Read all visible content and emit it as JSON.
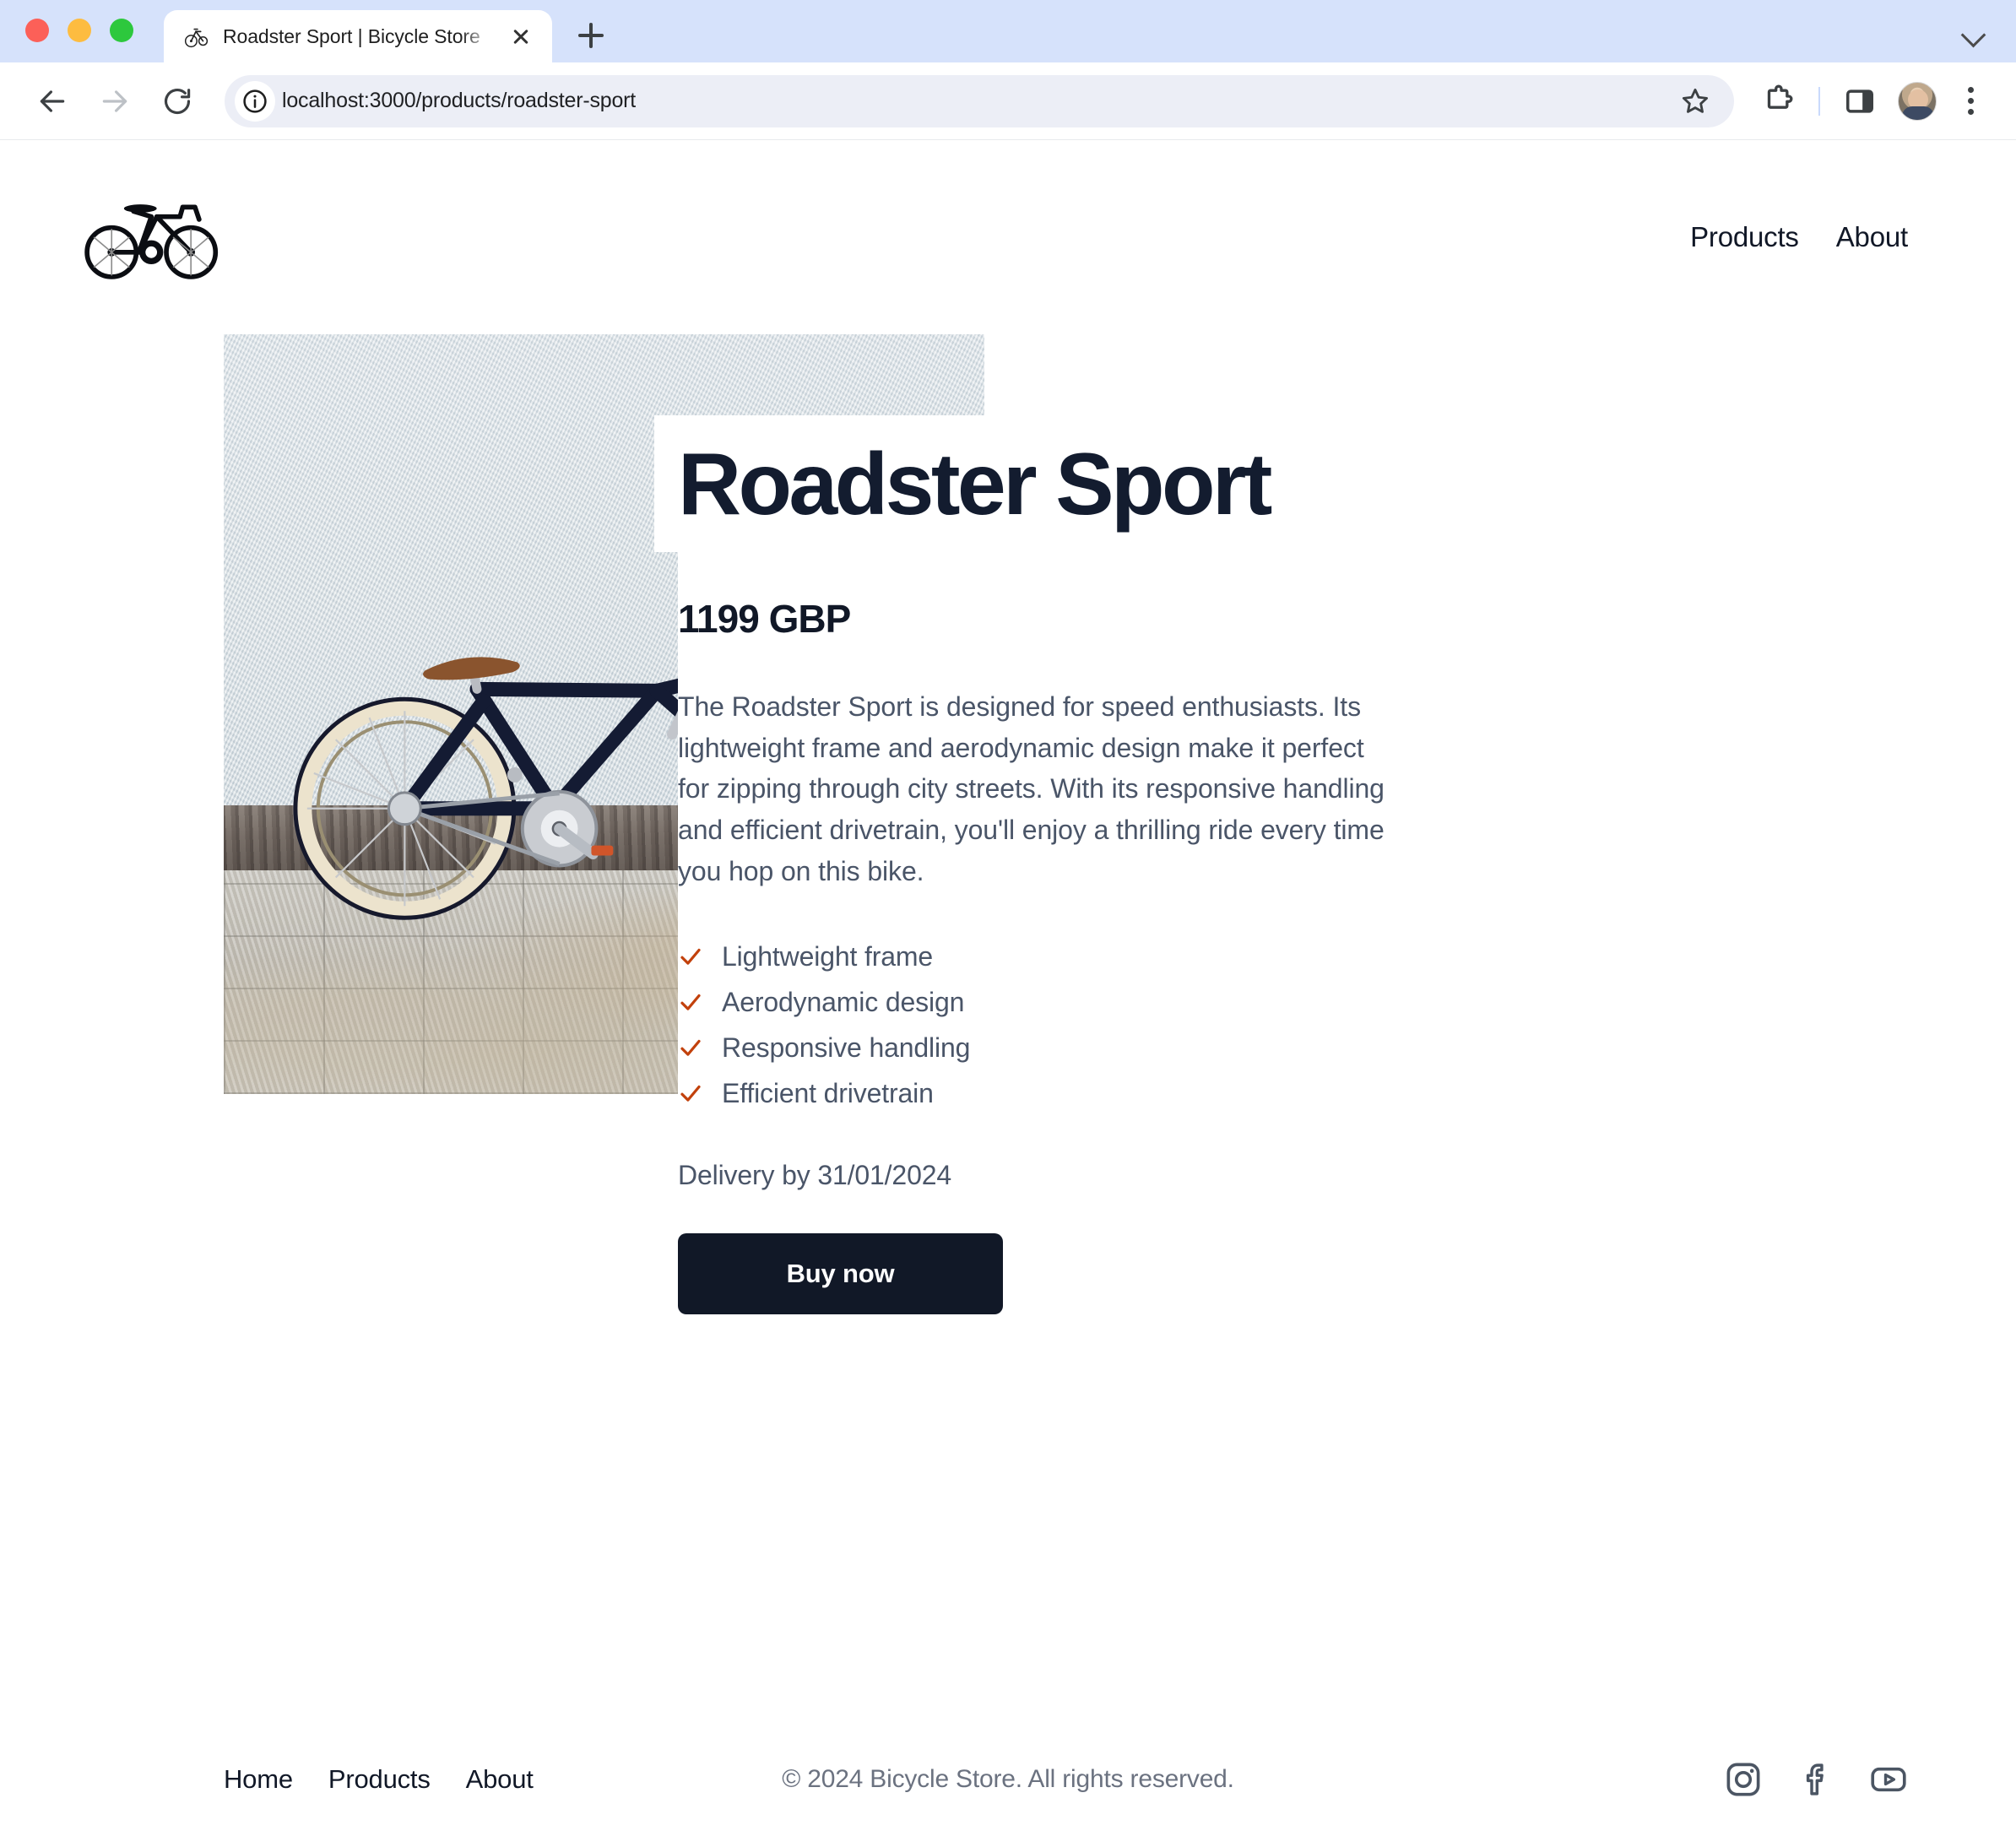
{
  "browser": {
    "tab": {
      "title": "Roadster Sport | Bicycle Store",
      "favicon_name": "bicycle-favicon",
      "close_label": "×"
    },
    "new_tab_label": "+",
    "toolbar": {
      "back_label": "Back",
      "forward_label": "Forward",
      "reload_label": "Reload",
      "site_info_label": "View site information",
      "url": "localhost:3000/products/roadster-sport",
      "bookmark_label": "Bookmark this tab",
      "extensions_label": "Extensions",
      "side_panel_label": "Side panel",
      "profile_label": "Profile",
      "menu_label": "Customize and control Google Chrome"
    },
    "tablist_menu_label": "Search tabs"
  },
  "header": {
    "logo_name": "bicycle-logo",
    "nav": [
      {
        "label": "Products",
        "name": "nav-products"
      },
      {
        "label": "About",
        "name": "nav-about"
      }
    ]
  },
  "product": {
    "image_alt": "Roadster Sport bicycle leaning against a white wall",
    "title": "Roadster Sport",
    "price": "1199 GBP",
    "description": "The Roadster Sport is designed for speed enthusiasts. Its lightweight frame and aerodynamic design make it perfect for zipping through city streets. With its responsive handling and efficient drivetrain, you'll enjoy a thrilling ride every time you hop on this bike.",
    "features": [
      "Lightweight frame",
      "Aerodynamic design",
      "Responsive handling",
      "Efficient drivetrain"
    ],
    "delivery": "Delivery by 31/01/2024",
    "buy_label": "Buy now"
  },
  "footer": {
    "nav": [
      {
        "label": "Home",
        "name": "footer-link-home"
      },
      {
        "label": "Products",
        "name": "footer-link-products"
      },
      {
        "label": "About",
        "name": "footer-link-about"
      }
    ],
    "copyright": "© 2024 Bicycle Store. All rights reserved.",
    "social": [
      {
        "name": "instagram-icon",
        "label": "Instagram"
      },
      {
        "name": "facebook-icon",
        "label": "Facebook"
      },
      {
        "name": "youtube-icon",
        "label": "YouTube"
      }
    ]
  },
  "colors": {
    "accent_check": "#c2410c",
    "title": "#131c2f",
    "button_bg": "#111827",
    "body_text": "#4a5568",
    "tabstrip_bg": "#d6e2fb",
    "omnibox_bg": "#eceef6"
  }
}
